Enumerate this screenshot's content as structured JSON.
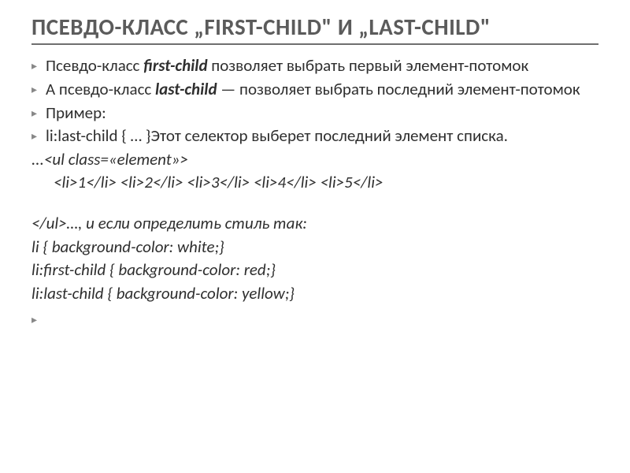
{
  "title": "ПСЕВДО-КЛАСС „FIRST-CHILD\" И „LAST-CHILD\"",
  "bullets": {
    "b1_pre": "Псевдо-класс ",
    "b1_bi": "first-child",
    "b1_post": " позволяет выбрать первый элемент-потомок",
    "b2_pre": "А псевдо-класс ",
    "b2_bi": "last-child",
    "b2_post": " —  позволяет выбрать последний элемент-потомок",
    "b3": "Пример:",
    "b4": "li:last-child { … }Этот селектор выберет последний элемент списка."
  },
  "code": {
    "l1": "...<ul class=«element»>",
    "l2": "<li>1</li>  <li>2</li>  <li>3</li>  <li>4</li>  <li>5</li>",
    "l3": "</ul>…, и если определить стиль так:",
    "l4": "li {   background-color: white;}",
    "l5": "li:first-child {    background-color: red;}",
    "l6": "li:last-child {    background-color: yellow;}"
  }
}
